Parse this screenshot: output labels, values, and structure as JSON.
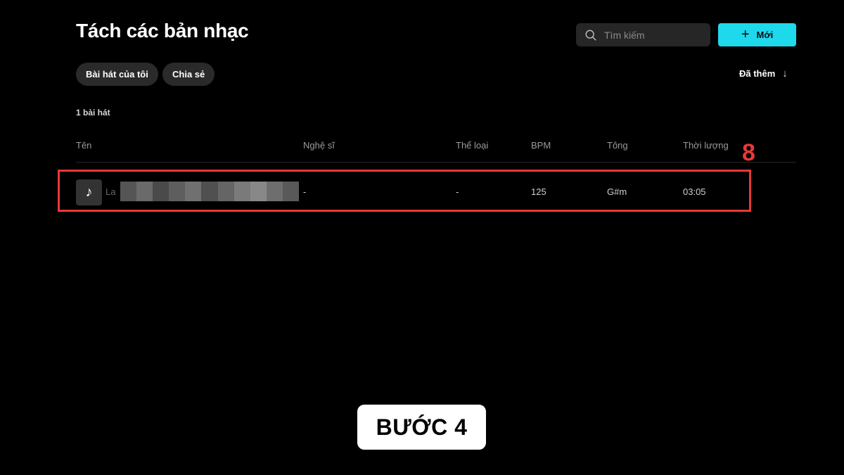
{
  "header": {
    "title": "Tách các bản nhạc",
    "search_placeholder": "Tìm kiếm",
    "new_button_label": "Mới"
  },
  "filters": {
    "my_songs": "Bài hát của tôi",
    "shared": "Chia sẻ"
  },
  "sort": {
    "label": "Đã thêm"
  },
  "song_count": "1 bài hát",
  "table": {
    "columns": [
      "Tên",
      "Nghệ sĩ",
      "Thể loại",
      "BPM",
      "Tông",
      "Thời lượng"
    ],
    "rows": [
      {
        "name": "La",
        "artist": "-",
        "genre": "-",
        "bpm": "125",
        "key": "G#m",
        "duration": "03:05"
      }
    ]
  },
  "annotations": {
    "step_marker": "8",
    "step_label": "BƯỚC 4",
    "highlight_color": "#e53938"
  },
  "colors": {
    "accent": "#1ed8ec",
    "background": "#000000"
  },
  "icons": {
    "search": "search-icon",
    "plus": "plus-icon",
    "sort_arrow": "arrow-down-icon",
    "song_thumb": "music-note-icon"
  }
}
